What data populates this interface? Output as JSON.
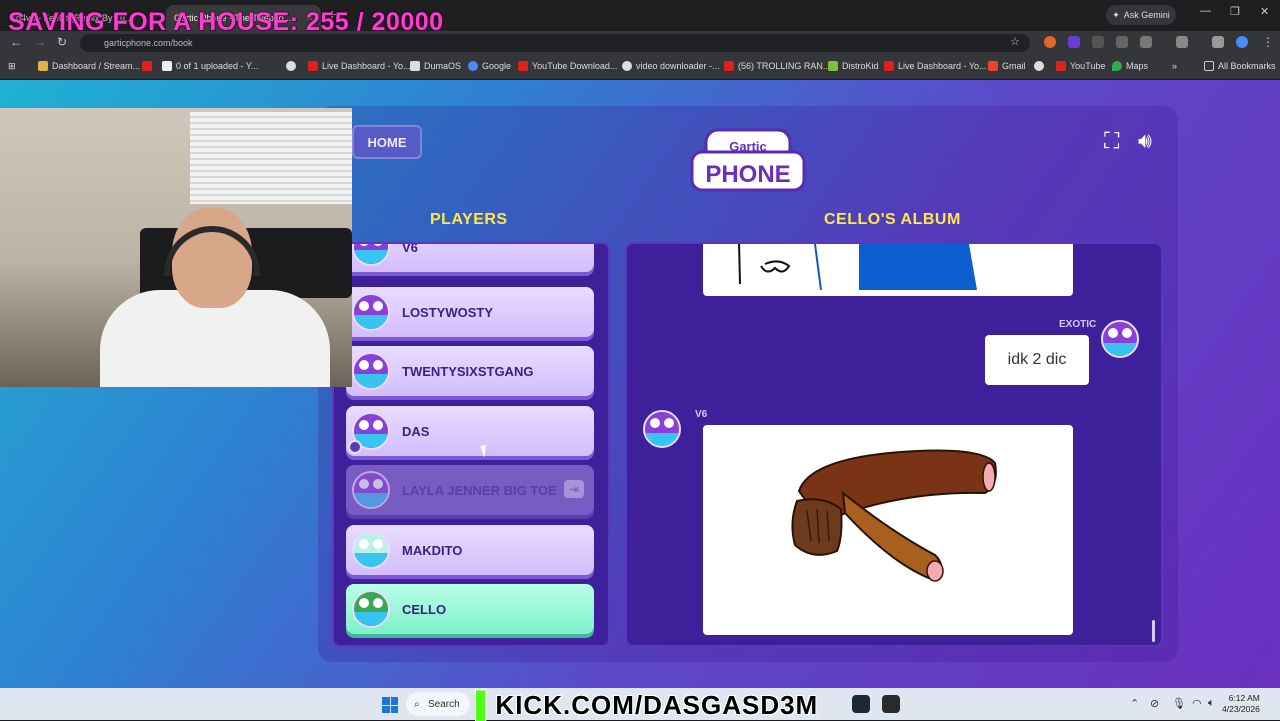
{
  "overlay": {
    "stream_title": "SAVING FOR A HOUSE: 255 / 20000",
    "kick_url": "KICK.COM/DASGASD3M"
  },
  "browser": {
    "tabs": [
      {
        "label": "d4vd - Feel It (Remix By Lu..."
      },
      {
        "label": "Gartic Phone - The Telepho..."
      }
    ],
    "ask_gemini": "Ask Gemini",
    "url": "garticphone.com/book",
    "bookmarks": [
      "Dashboard / Stream...",
      "0 of 1 uploaded - Y...",
      "Live Dashboard - Yo...",
      "DumaOS",
      "Google",
      "YouTube Download...",
      "video downloader -...",
      "(56) TROLLING RAN...",
      "DistroKid",
      "Live Dashboard - Yo...",
      "Gmail",
      "YouTube",
      "Maps"
    ],
    "all_bookmarks": "All Bookmarks"
  },
  "game": {
    "home_label": "HOME",
    "logo_top": "Gartic",
    "logo_main": "PHONE",
    "players_heading": "PLAYERS",
    "album_heading": "CELLO'S ALBUM",
    "players": [
      {
        "name": "V6"
      },
      {
        "name": "LOSTYWOSTY"
      },
      {
        "name": "TWENTYSIXSTGANG"
      },
      {
        "name": "DAS"
      },
      {
        "name": "LAYLA JENNER BIG TOE"
      },
      {
        "name": "MAKDITO"
      },
      {
        "name": "CELLO"
      }
    ],
    "album": {
      "entries": [
        {
          "user": "EXOTIC",
          "text": "idk 2 dic"
        },
        {
          "user": "V6"
        }
      ]
    }
  },
  "taskbar": {
    "search": "Search",
    "time": "6:12 AM",
    "date": "4/23/2026"
  },
  "colors": {
    "heading": "#ffe74a",
    "overlay_pink": "#ff3bd2",
    "kick_green": "#53fc18"
  }
}
